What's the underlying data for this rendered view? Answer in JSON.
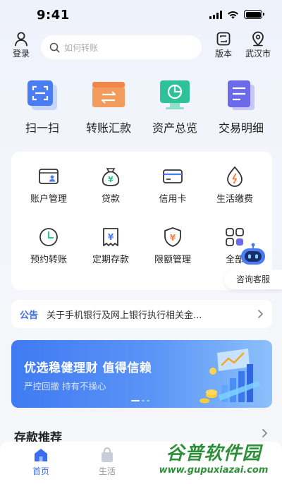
{
  "status_bar": {
    "time": "9:41"
  },
  "header": {
    "login_label": "登录",
    "search_placeholder": "如何转账",
    "version_label": "版本",
    "city_label": "武汉市"
  },
  "quick_actions": [
    {
      "label": "扫一扫",
      "icon": "scan-icon"
    },
    {
      "label": "转账汇款",
      "icon": "transfer-icon"
    },
    {
      "label": "资产总览",
      "icon": "asset-overview-icon"
    },
    {
      "label": "交易明细",
      "icon": "transaction-detail-icon"
    }
  ],
  "services": [
    {
      "label": "账户管理",
      "icon": "account-card-icon"
    },
    {
      "label": "贷款",
      "icon": "loan-bag-icon"
    },
    {
      "label": "信用卡",
      "icon": "credit-card-icon"
    },
    {
      "label": "生活缴费",
      "icon": "utility-drop-icon"
    },
    {
      "label": "预约转账",
      "icon": "clock-icon"
    },
    {
      "label": "定期存款",
      "icon": "deposit-icon"
    },
    {
      "label": "限额管理",
      "icon": "shield-yen-icon"
    },
    {
      "label": "全部",
      "icon": "all-apps-icon"
    }
  ],
  "assistant": {
    "label": "咨询客服",
    "icon": "robot-icon"
  },
  "notice": {
    "tag": "公告",
    "text": "关于手机银行及网上银行执行相关金..."
  },
  "banner": {
    "title": "优选稳健理财  值得信赖",
    "subtitle": "严控回撤  持有不操心"
  },
  "section": {
    "title": "存款推荐"
  },
  "tabs": [
    {
      "label": "首页",
      "active": true
    },
    {
      "label": "生活",
      "active": false
    }
  ],
  "watermark": {
    "text": "谷普软件园",
    "url": "www.gupuxiazai.com"
  },
  "colors": {
    "accent": "#3a6df0",
    "text": "#222222"
  }
}
